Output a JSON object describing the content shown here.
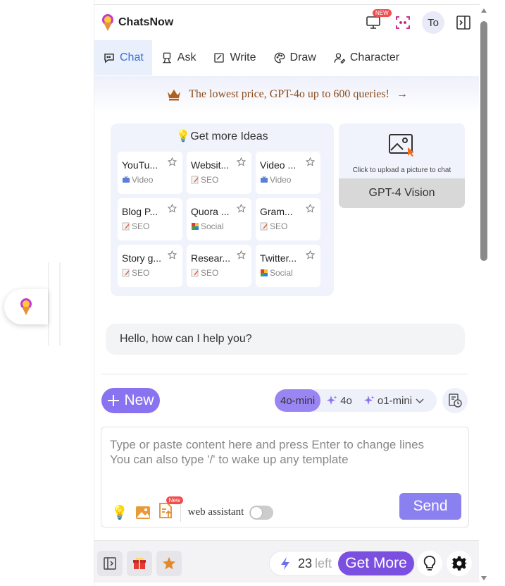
{
  "header": {
    "app_name": "ChatsNow",
    "new_badge": "NEW",
    "avatar_initials": "To"
  },
  "tabs": [
    {
      "label": "Chat",
      "icon": "chat-bubble-icon",
      "active": true
    },
    {
      "label": "Ask",
      "icon": "ask-icon",
      "active": false
    },
    {
      "label": "Write",
      "icon": "write-icon",
      "active": false
    },
    {
      "label": "Draw",
      "icon": "palette-icon",
      "active": false
    },
    {
      "label": "Character",
      "icon": "character-icon",
      "active": false
    }
  ],
  "banner": {
    "text": "The lowest price, GPT-4o up to 600 queries!",
    "arrow": "→"
  },
  "ideas": {
    "title": "Get more Ideas",
    "cards": [
      {
        "title": "YouTu...",
        "tag": "Video"
      },
      {
        "title": "Websit...",
        "tag": "SEO"
      },
      {
        "title": "Video ...",
        "tag": "Video"
      },
      {
        "title": "Blog P...",
        "tag": "SEO"
      },
      {
        "title": "Quora ...",
        "tag": "Social"
      },
      {
        "title": "Gram...",
        "tag": "SEO"
      },
      {
        "title": "Story g...",
        "tag": "SEO"
      },
      {
        "title": "Resear...",
        "tag": "SEO"
      },
      {
        "title": "Twitter...",
        "tag": "Social"
      }
    ]
  },
  "vision": {
    "hint": "Click to upload a picture to chat",
    "button_label": "GPT-4 Vision"
  },
  "greeting": "Hello, how can I help you?",
  "composer": {
    "new_label": "New",
    "models": [
      {
        "label": "4o-mini",
        "active": true
      },
      {
        "label": "4o",
        "active": false
      },
      {
        "label": "o1-mini",
        "active": false
      }
    ],
    "placeholder_line1": "Type or paste content here and press Enter to change lines",
    "placeholder_line2": "You can also type '/' to wake up any template",
    "tool_new_badge": "New",
    "web_assistant_label": "web assistant",
    "web_assistant_enabled": false,
    "send_label": "Send"
  },
  "footer": {
    "quota_count": "23",
    "quota_suffix": "left",
    "get_more_label": "Get More"
  },
  "colors": {
    "accent": "#8a73f0",
    "tab_active_bg": "#e9f0fb",
    "tab_active_text": "#3b6fd6",
    "banner_text": "#8a4a1a",
    "get_more": "#7b4fe0",
    "badge_red": "#f24e4e"
  }
}
